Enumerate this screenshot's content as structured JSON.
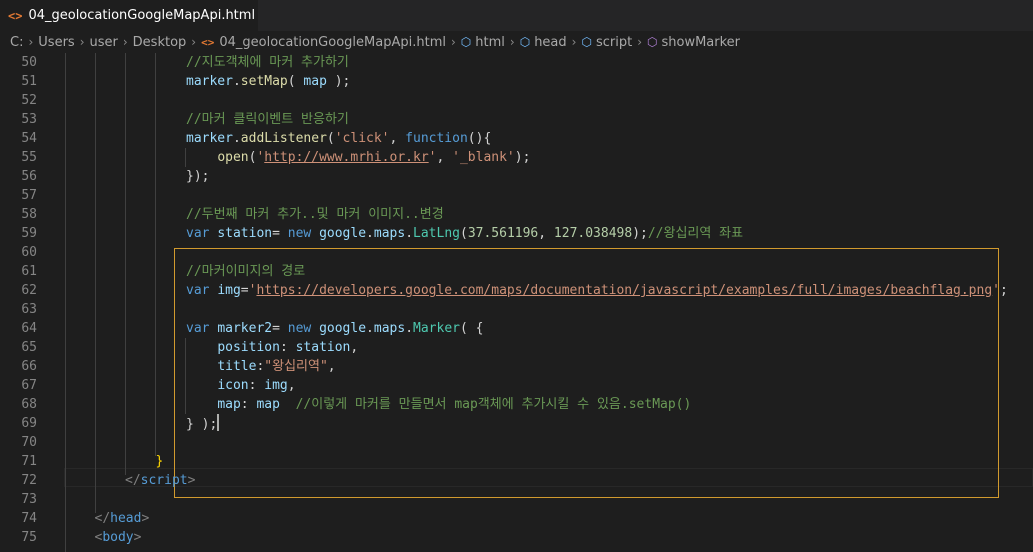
{
  "tab": {
    "icon": "<>",
    "filename": "04_geolocationGoogleMapApi.html"
  },
  "breadcrumb": {
    "items": [
      "C:",
      "Users",
      "user",
      "Desktop",
      "04_geolocationGoogleMapApi.html",
      "html",
      "head",
      "script",
      "showMarker"
    ],
    "file_icon": "<>"
  },
  "editor": {
    "lines": [
      {
        "n": "50",
        "t": [
          [
            "c",
            "//지도객체에 마커 추가하기"
          ]
        ]
      },
      {
        "n": "51",
        "t": [
          [
            "v",
            "marker"
          ],
          [
            "p",
            "."
          ],
          [
            "f",
            "setMap"
          ],
          [
            "p",
            "( "
          ],
          [
            "v",
            "map"
          ],
          [
            "p",
            " );"
          ]
        ]
      },
      {
        "n": "52",
        "t": []
      },
      {
        "n": "53",
        "t": [
          [
            "c",
            "//마커 클릭이벤트 반응하기"
          ]
        ]
      },
      {
        "n": "54",
        "t": [
          [
            "v",
            "marker"
          ],
          [
            "p",
            "."
          ],
          [
            "f",
            "addListener"
          ],
          [
            "p",
            "("
          ],
          [
            "s",
            "'click'"
          ],
          [
            "p",
            ", "
          ],
          [
            "k",
            "function"
          ],
          [
            "p",
            "(){"
          ]
        ]
      },
      {
        "n": "55",
        "t": [
          [
            "p",
            "    "
          ],
          [
            "f",
            "open"
          ],
          [
            "p",
            "("
          ],
          [
            "s",
            "'"
          ],
          [
            "u",
            "http://www.mrhi.or.kr"
          ],
          [
            "s",
            "'"
          ],
          [
            "p",
            ", "
          ],
          [
            "s",
            "'_blank'"
          ],
          [
            "p",
            ");"
          ]
        ]
      },
      {
        "n": "56",
        "t": [
          [
            "p",
            "});"
          ]
        ]
      },
      {
        "n": "57",
        "t": []
      },
      {
        "n": "58",
        "t": [
          [
            "c",
            "//두번째 마커 추가..및 마커 이미지..변경"
          ]
        ]
      },
      {
        "n": "59",
        "t": [
          [
            "k",
            "var"
          ],
          [
            "p",
            " "
          ],
          [
            "v",
            "station"
          ],
          [
            "p",
            "= "
          ],
          [
            "k",
            "new"
          ],
          [
            "p",
            " "
          ],
          [
            "v",
            "google"
          ],
          [
            "p",
            "."
          ],
          [
            "v",
            "maps"
          ],
          [
            "p",
            "."
          ],
          [
            "t",
            "LatLng"
          ],
          [
            "p",
            "("
          ],
          [
            "n",
            "37.561196"
          ],
          [
            "p",
            ", "
          ],
          [
            "n",
            "127.038498"
          ],
          [
            "p",
            ");"
          ],
          [
            "c",
            "//왕십리역 좌표"
          ]
        ]
      },
      {
        "n": "60",
        "t": []
      },
      {
        "n": "61",
        "t": [
          [
            "c",
            "//마커이미지의 경로"
          ]
        ]
      },
      {
        "n": "62",
        "t": [
          [
            "k",
            "var"
          ],
          [
            "p",
            " "
          ],
          [
            "v",
            "img"
          ],
          [
            "p",
            "="
          ],
          [
            "s",
            "'"
          ],
          [
            "u",
            "https://developers.google.com/maps/documentation/javascript/examples/full/images/beachflag.png"
          ],
          [
            "s",
            "'"
          ],
          [
            "p",
            ";"
          ]
        ]
      },
      {
        "n": "63",
        "t": []
      },
      {
        "n": "64",
        "t": [
          [
            "k",
            "var"
          ],
          [
            "p",
            " "
          ],
          [
            "v",
            "marker2"
          ],
          [
            "p",
            "= "
          ],
          [
            "k",
            "new"
          ],
          [
            "p",
            " "
          ],
          [
            "v",
            "google"
          ],
          [
            "p",
            "."
          ],
          [
            "v",
            "maps"
          ],
          [
            "p",
            "."
          ],
          [
            "t",
            "Marker"
          ],
          [
            "p",
            "( {"
          ]
        ]
      },
      {
        "n": "65",
        "t": [
          [
            "p",
            "    "
          ],
          [
            "v",
            "position"
          ],
          [
            "p",
            ": "
          ],
          [
            "v",
            "station"
          ],
          [
            "p",
            ","
          ]
        ]
      },
      {
        "n": "66",
        "t": [
          [
            "p",
            "    "
          ],
          [
            "v",
            "title"
          ],
          [
            "p",
            ":"
          ],
          [
            "s",
            "\"왕십리역\""
          ],
          [
            "p",
            ","
          ]
        ]
      },
      {
        "n": "67",
        "t": [
          [
            "p",
            "    "
          ],
          [
            "v",
            "icon"
          ],
          [
            "p",
            ": "
          ],
          [
            "v",
            "img"
          ],
          [
            "p",
            ","
          ]
        ]
      },
      {
        "n": "68",
        "t": [
          [
            "p",
            "    "
          ],
          [
            "v",
            "map"
          ],
          [
            "p",
            ": "
          ],
          [
            "v",
            "map"
          ],
          [
            "p",
            "  "
          ],
          [
            "c",
            "//이렇게 마커를 만들면서 map객체에 추가시킬 수 있음.setMap()"
          ]
        ]
      },
      {
        "n": "69",
        "t": [
          [
            "p",
            "} );"
          ]
        ],
        "cursor": true
      },
      {
        "n": "70",
        "t": []
      },
      {
        "n": "71",
        "t": [
          [
            "b",
            "}"
          ]
        ]
      },
      {
        "n": "72",
        "t": [
          [
            "g",
            "</"
          ],
          [
            "k",
            "script"
          ],
          [
            "g",
            ">"
          ]
        ]
      },
      {
        "n": "73",
        "t": []
      },
      {
        "n": "74",
        "t": [
          [
            "g",
            "</"
          ],
          [
            "k",
            "head"
          ],
          [
            "g",
            ">"
          ]
        ]
      },
      {
        "n": "75",
        "t": [
          [
            "g",
            "<"
          ],
          [
            "k",
            "body"
          ],
          [
            "g",
            ">"
          ]
        ]
      }
    ]
  },
  "colors": {
    "background": "#1e1e1e",
    "comment": "#6a9955",
    "variable": "#9cdcfe",
    "function": "#dcdcaa",
    "string": "#ce9178",
    "keyword": "#569cd6",
    "number": "#b5cea8",
    "type": "#4ec9b0",
    "selection_border": "#d19a2e",
    "file_icon": "#e37933"
  }
}
